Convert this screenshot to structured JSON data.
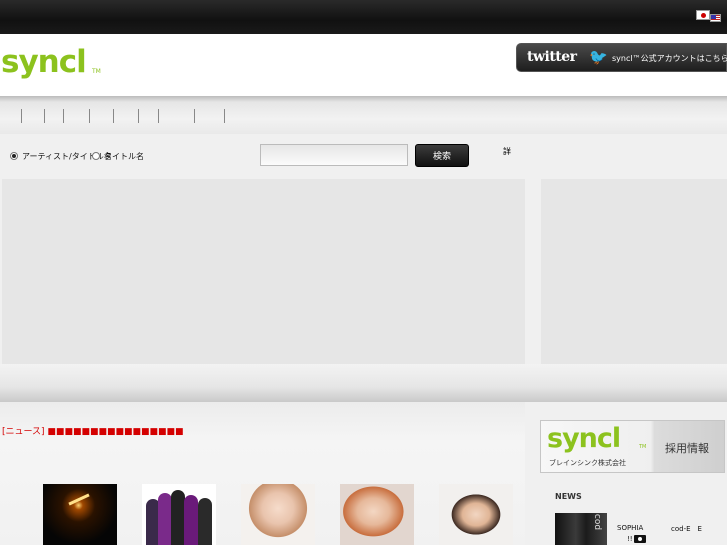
{
  "header": {
    "logo": "syncl",
    "logo_tm": "TM",
    "twitter_word": "twitter",
    "twitter_text": "syncl™公式アカウントはこちら",
    "languages": [
      {
        "name": "Japanese",
        "icon": "japan-flag-icon"
      },
      {
        "name": "English",
        "icon": "us-flag-icon"
      }
    ]
  },
  "search": {
    "option_1": "アーティスト/タイトル名",
    "option_2": "タイトル名",
    "placeholder": "",
    "button": "検索",
    "extra": "詳"
  },
  "headline": "[ニュース] ■■■■■■■■■■■■■■■■",
  "thumbnails": [
    {
      "icon": "live-stage-photo"
    },
    {
      "icon": "group-photo"
    },
    {
      "icon": "portrait-photo"
    },
    {
      "icon": "portrait-photo"
    },
    {
      "icon": "portrait-photo"
    }
  ],
  "recruit": {
    "logo": "syncl",
    "tm": "TM",
    "company": "ブレインシンク株式会社",
    "label": "採用情報"
  },
  "news": {
    "title": "NEWS",
    "item_1": "SOPHIA",
    "item_2": "cod-E　E",
    "item_3": "!!"
  },
  "colors": {
    "brand_green": "#8cc21e",
    "headline_red": "#d40000",
    "top_bar": "#111111"
  }
}
